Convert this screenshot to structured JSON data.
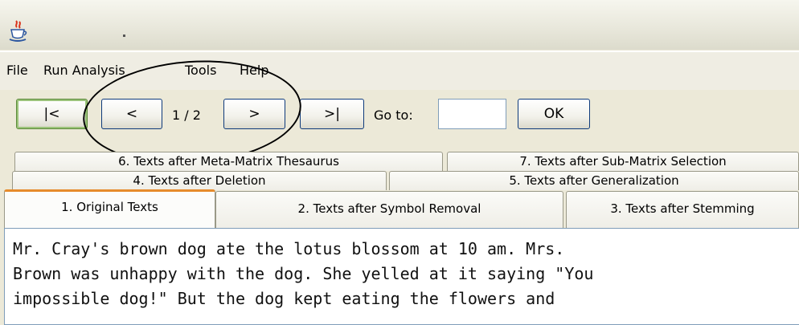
{
  "window": {
    "icon": "java-cup-icon"
  },
  "menu": [
    "File",
    "Run Analysis",
    "Tools",
    "Help"
  ],
  "toolbar": {
    "first_label": "|<",
    "prev_label": "<",
    "page_indicator": "1 / 2",
    "next_label": ">",
    "last_label": ">|",
    "goto_label": "Go to:",
    "goto_value": "",
    "ok_label": "OK"
  },
  "tabs": {
    "row3": [
      "6. Texts after Meta-Matrix Thesaurus",
      "7. Texts after Sub-Matrix Selection"
    ],
    "row2": [
      "4. Texts after Deletion",
      "5. Texts after Generalization"
    ],
    "row1": [
      "1. Original Texts",
      "2. Texts after Symbol Removal",
      "3. Texts after Stemming"
    ],
    "selected": "1. Original Texts"
  },
  "content": {
    "lines": [
      "Mr. Cray's brown dog ate the lotus blossom at 10 am. Mrs.",
      "Brown was unhappy with the dog. She yelled at it saying \"You",
      "impossible dog!\" But the dog kept eating the flowers and"
    ]
  },
  "colors": {
    "tab_selected_accent": "#e68b2c",
    "background": "#ece9d8"
  }
}
